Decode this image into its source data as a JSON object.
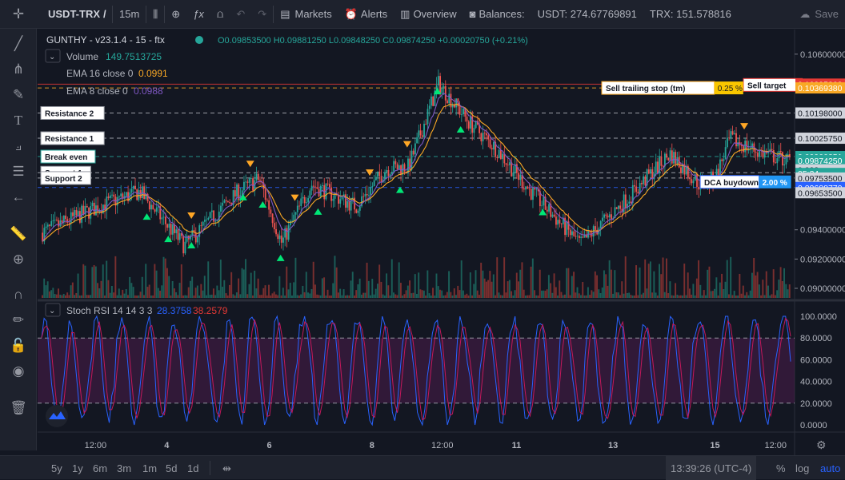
{
  "toolbar": {
    "symbol": "USDT-TRX",
    "interval": "15m",
    "markets": "Markets",
    "alerts": "Alerts",
    "overview": "Overview",
    "balances": "Balances:",
    "usdt_balance": "USDT: 274.67769891",
    "trx_balance": "TRX: 151.578816",
    "save": "Save",
    "symbol_truncated": "/"
  },
  "legend": {
    "title": "GUNTHY - v23.1.4 - 15 - ftx",
    "ohlc": "O0.09853500 H0.09881250 L0.09848250 C0.09874250 +0.00020750 (+0.21%)",
    "volume_label": "Volume",
    "volume_value": "149.7513725",
    "ema16_label": "EMA 16 close 0",
    "ema16_value": "0.0991",
    "ema8_label": "EMA 8 close 0",
    "ema8_value": "0.0988",
    "stoch_label": "Stoch RSI 14 14 3 3",
    "stoch_k": "28.3758",
    "stoch_d": "38.2579"
  },
  "chart_data": [
    {
      "type": "candlestick",
      "name": "price",
      "ylim": [
        0.0894,
        0.1073
      ],
      "x_ticks": [
        "12:00",
        "4",
        "6",
        "8",
        "12:00",
        "11",
        "13",
        "15",
        "12:00"
      ],
      "y_ticks": [
        "0.10600000",
        "0.09400000",
        "0.09200000",
        "0.09000000"
      ],
      "price_labels": [
        {
          "value": "0.10395368",
          "color": "#e53935"
        },
        {
          "value": "0.10369380",
          "color": "#f9a825"
        },
        {
          "value": "0.10198000",
          "color": "#d1d4dc"
        },
        {
          "value": "0.10025750",
          "color": "#d1d4dc"
        },
        {
          "value": "0.09900351",
          "color": "#26a69a"
        },
        {
          "value": "0.09874250",
          "color": "#26a69a"
        },
        {
          "value": "0.098",
          "color": "#d1d4dc"
        },
        {
          "value": "05:34",
          "color": "#26a69a"
        },
        {
          "value": "0.09753500",
          "color": "#d1d4dc"
        },
        {
          "value": "0.09688770",
          "color": "#2962ff"
        },
        {
          "value": "0.09653500",
          "color": "#d1d4dc"
        }
      ],
      "lines": [
        {
          "label": "Resistance 2",
          "value": 0.10198
        },
        {
          "label": "Resistance 1",
          "value": 0.1002575
        },
        {
          "label": "Break even",
          "value": 0.09900351
        },
        {
          "label": "Support 1",
          "value": 0.0979
        },
        {
          "label": "Support 2",
          "value": 0.097535
        },
        {
          "label": "Sell target",
          "value": 0.10395368
        },
        {
          "label": "Sell trailing stop (tm)",
          "value": 0.1036938
        },
        {
          "label": "DCA buydown",
          "value": 0.0968877
        }
      ],
      "badges": {
        "trailing_pct": "0.25 %",
        "dca_pct": "2.00 %"
      }
    },
    {
      "type": "line",
      "name": "Stoch RSI 14 14 3 3",
      "ylim": [
        0,
        100
      ],
      "y_ticks": [
        "100.0000",
        "80.0000",
        "60.0000",
        "40.0000",
        "20.0000",
        "0.0000"
      ],
      "bands": [
        20,
        80
      ],
      "series": [
        {
          "name": "K",
          "color": "#2962ff"
        },
        {
          "name": "D",
          "color": "#c2185b"
        }
      ]
    }
  ],
  "bottom": {
    "ranges": [
      "5y",
      "1y",
      "6m",
      "3m",
      "1m",
      "5d",
      "1d"
    ],
    "time": "13:39:26 (UTC-4)",
    "percent": "%",
    "log": "log",
    "auto": "auto"
  }
}
